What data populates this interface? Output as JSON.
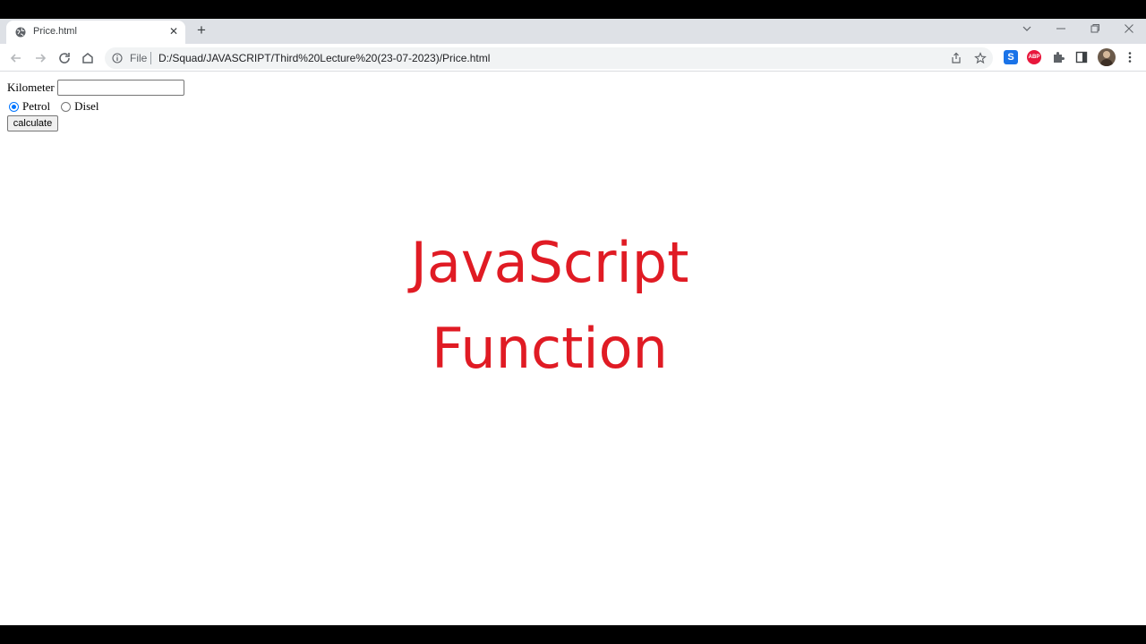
{
  "tab": {
    "title": "Price.html"
  },
  "omnibox": {
    "scheme_label": "File",
    "url": "D:/Squad/JAVASCRIPT/Third%20Lecture%20(23-07-2023)/Price.html"
  },
  "extensions": {
    "s_label": "S",
    "abp_label": "ABP"
  },
  "form": {
    "kilometer_label": "Kilometer",
    "kilometer_value": "",
    "petrol_label": "Petrol",
    "disel_label": "Disel",
    "selected": "Petrol",
    "button_label": "calculate"
  },
  "overlay": {
    "line1": "JavaScript",
    "line2": "Function",
    "color": "#e01b24"
  }
}
